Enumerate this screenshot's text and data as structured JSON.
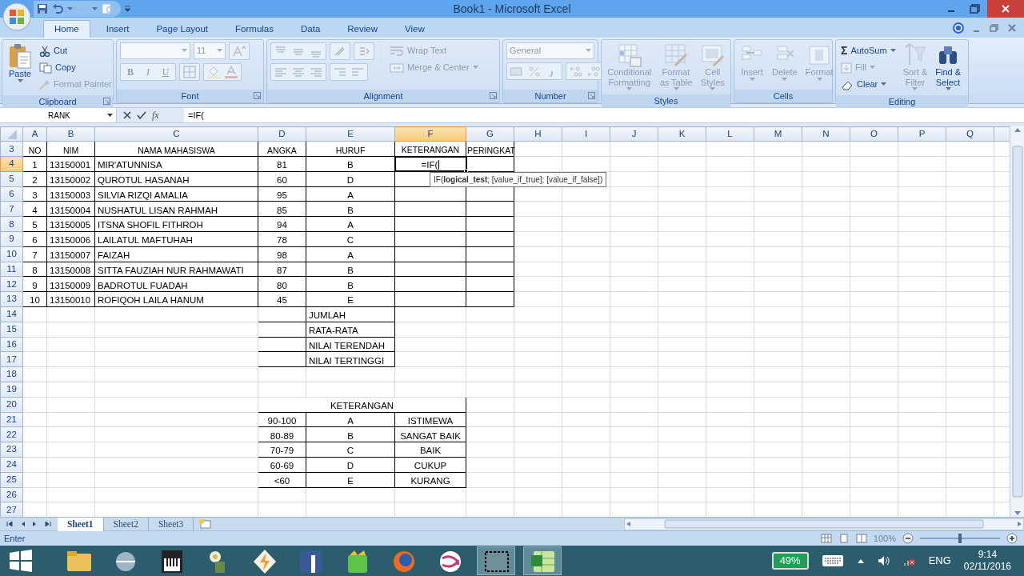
{
  "title_bar": {
    "title": "Book1 - Microsoft Excel"
  },
  "ribbon_tabs": [
    {
      "label": "Home",
      "selected": true
    },
    {
      "label": "Insert",
      "selected": false
    },
    {
      "label": "Page Layout",
      "selected": false
    },
    {
      "label": "Formulas",
      "selected": false
    },
    {
      "label": "Data",
      "selected": false
    },
    {
      "label": "Review",
      "selected": false
    },
    {
      "label": "View",
      "selected": false
    }
  ],
  "ribbon_groups": [
    {
      "kind": "clipboard",
      "label": "Clipboard",
      "large": [
        {
          "lines": [
            "Paste"
          ],
          "disabled": false
        }
      ],
      "small": [
        {
          "label": "Cut",
          "disabled": false
        },
        {
          "label": "Copy",
          "disabled": false
        },
        {
          "label": "Format Painter",
          "disabled": true
        }
      ]
    },
    {
      "kind": "font",
      "label": "Font",
      "font_size": "11",
      "style_buttons": [
        "B",
        "I",
        "U"
      ],
      "disabled": true
    },
    {
      "kind": "alignment",
      "label": "Alignment",
      "small": [
        {
          "label": "Wrap Text",
          "disabled": true
        },
        {
          "label": "Merge & Center",
          "disabled": true
        }
      ]
    },
    {
      "kind": "number",
      "label": "Number",
      "format": "General",
      "disabled": true
    },
    {
      "kind": "styles",
      "label": "Styles",
      "large": [
        {
          "lines": [
            "Conditional",
            "Formatting"
          ],
          "disabled": true
        },
        {
          "lines": [
            "Format",
            "as Table"
          ],
          "disabled": true
        },
        {
          "lines": [
            "Cell",
            "Styles"
          ],
          "disabled": true
        }
      ]
    },
    {
      "kind": "cells",
      "label": "Cells",
      "large": [
        {
          "lines": [
            "Insert"
          ],
          "disabled": true
        },
        {
          "lines": [
            "Delete"
          ],
          "disabled": true
        },
        {
          "lines": [
            "Format"
          ],
          "disabled": true
        }
      ]
    },
    {
      "kind": "editing",
      "label": "Editing",
      "small": [
        {
          "icon": "Σ",
          "label": "AutoSum",
          "disabled": false
        },
        {
          "label": "Fill",
          "disabled": true
        },
        {
          "label": "Clear",
          "disabled": false
        }
      ],
      "large": [
        {
          "lines": [
            "Sort &",
            "Filter"
          ],
          "disabled": true
        },
        {
          "lines": [
            "Find &",
            "Select"
          ],
          "disabled": false
        }
      ]
    }
  ],
  "formula_bar": {
    "name_box": "RANK",
    "function_label": "fx",
    "formula": "=IF("
  },
  "spreadsheet": {
    "columns": [
      {
        "label": "A",
        "selected": false
      },
      {
        "label": "B",
        "selected": false
      },
      {
        "label": "C",
        "selected": false
      },
      {
        "label": "D",
        "selected": false
      },
      {
        "label": "E",
        "selected": false
      },
      {
        "label": "F",
        "selected": true
      },
      {
        "label": "G",
        "selected": false
      },
      {
        "label": "H",
        "selected": false
      },
      {
        "label": "I",
        "selected": false
      },
      {
        "label": "J",
        "selected": false
      },
      {
        "label": "K",
        "selected": false
      },
      {
        "label": "L",
        "selected": false
      },
      {
        "label": "M",
        "selected": false
      },
      {
        "label": "N",
        "selected": false
      },
      {
        "label": "O",
        "selected": false
      },
      {
        "label": "P",
        "selected": false
      },
      {
        "label": "Q",
        "selected": false
      }
    ],
    "row_numbers": [
      {
        "label": "3",
        "selected": false
      },
      {
        "label": "4",
        "selected": true
      },
      {
        "label": "5",
        "selected": false
      },
      {
        "label": "6",
        "selected": false
      },
      {
        "label": "7",
        "selected": false
      },
      {
        "label": "8",
        "selected": false
      },
      {
        "label": "9",
        "selected": false
      },
      {
        "label": "10",
        "selected": false
      },
      {
        "label": "11",
        "selected": false
      },
      {
        "label": "12",
        "selected": false
      },
      {
        "label": "13",
        "selected": false
      },
      {
        "label": "14",
        "selected": false
      },
      {
        "label": "15",
        "selected": false
      },
      {
        "label": "16",
        "selected": false
      },
      {
        "label": "17",
        "selected": false
      },
      {
        "label": "18",
        "selected": false
      },
      {
        "label": "19",
        "selected": false
      },
      {
        "label": "20",
        "selected": false
      },
      {
        "label": "21",
        "selected": false
      },
      {
        "label": "22",
        "selected": false
      },
      {
        "label": "23",
        "selected": false
      },
      {
        "label": "24",
        "selected": false
      },
      {
        "label": "25",
        "selected": false
      },
      {
        "label": "26",
        "selected": false
      },
      {
        "label": "27",
        "selected": false
      }
    ],
    "main_table": {
      "headers": [
        "NO",
        "NIM",
        "NAMA MAHASISWA",
        "ANGKA",
        "HURUF",
        "KETERANGAN",
        "PERINGKAT"
      ],
      "rows": [
        {
          "cells": [
            "1",
            "13150001",
            "MIR'ATUNNISA",
            "81",
            "B"
          ],
          "editing_text": "=IF("
        },
        {
          "cells": [
            "2",
            "13150002",
            "QUROTUL HASANAH",
            "60",
            "D"
          ]
        },
        {
          "cells": [
            "3",
            "13150003",
            "SILVIA RIZQI AMALIA",
            "95",
            "A"
          ]
        },
        {
          "cells": [
            "4",
            "13150004",
            "NUSHATUL LISAN RAHMAH",
            "85",
            "B"
          ]
        },
        {
          "cells": [
            "5",
            "13150005",
            "ITSNA SHOFIL FITHROH",
            "94",
            "A"
          ]
        },
        {
          "cells": [
            "6",
            "13150006",
            "LAILATUL MAFTUHAH",
            "78",
            "C"
          ]
        },
        {
          "cells": [
            "7",
            "13150007",
            "FAIZAH",
            "98",
            "A"
          ]
        },
        {
          "cells": [
            "8",
            "13150008",
            "SITTA FAUZIAH NUR RAHMAWATI",
            "87",
            "B"
          ]
        },
        {
          "cells": [
            "9",
            "13150009",
            "BADROTUL FUADAH",
            "80",
            "B"
          ]
        },
        {
          "cells": [
            "10",
            "13150010",
            "ROFIQOH LAILA HANUM",
            "45",
            "E"
          ]
        }
      ]
    },
    "summary_table": {
      "labels": [
        "JUMLAH",
        "RATA-RATA",
        "NILAI TERENDAH",
        "NILAI TERTINGGI"
      ]
    },
    "legend_table": {
      "title": "KETERANGAN",
      "rows": [
        [
          "90-100",
          "A",
          "ISTIMEWA"
        ],
        [
          "80-89",
          "B",
          "SANGAT BAIK"
        ],
        [
          "70-79",
          "C",
          "BAIK"
        ],
        [
          "60-69",
          "D",
          "CUKUP"
        ],
        [
          "<60",
          "E",
          "KURANG"
        ]
      ]
    },
    "function_tooltip": "IF(**logical_test**; [value_if_true]; [value_if_false])"
  },
  "sheet_tabs": [
    {
      "label": "Sheet1",
      "selected": true
    },
    {
      "label": "Sheet2",
      "selected": false
    },
    {
      "label": "Sheet3",
      "selected": false
    }
  ],
  "status_bar": {
    "mode": "Enter",
    "zoom_label": "100%",
    "zoom": {
      "level": 0.5
    }
  },
  "taskbar": {
    "apps": [
      {
        "selected": false
      },
      {
        "selected": false
      },
      {
        "selected": false
      },
      {
        "selected": false
      },
      {
        "selected": false
      },
      {
        "selected": false
      },
      {
        "selected": false
      },
      {
        "selected": false
      },
      {
        "selected": false
      },
      {
        "selected": true
      },
      {
        "selected": true
      }
    ],
    "battery": "49%",
    "language": "ENG",
    "time": "9:14",
    "date": "02/11/2016"
  }
}
